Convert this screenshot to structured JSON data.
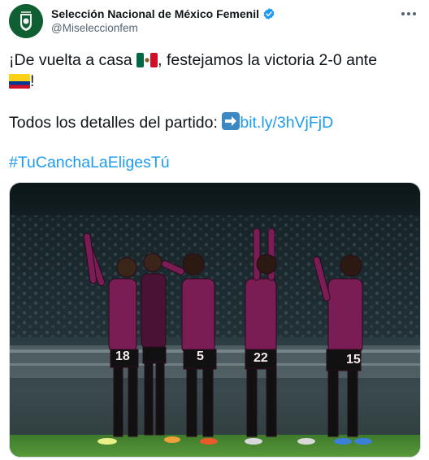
{
  "account": {
    "display_name": "Selección Nacional de México Femenil",
    "handle": "@Miseleccionfem",
    "verified": true,
    "brand_color": "#0f5f32"
  },
  "tweet": {
    "line1": "¡De vuelta a casa",
    "line1_after_flag": ", festejamos la victoria 2-0 ante",
    "line2_after_flag": "!",
    "details_label": "Todos los detalles del partido:",
    "link": "bit.ly/3hVjFjD",
    "hashtag": "#TuCanchaLaEligesTú",
    "link_color": "#1d9bf0"
  },
  "icons": {
    "more": "more-options-icon",
    "verified": "verified-badge-icon",
    "arrow": "right-arrow-icon",
    "flag_mexico": "mexico-flag-icon",
    "flag_colombia": "colombia-flag-icon"
  },
  "photo": {
    "jersey_numbers": [
      "18",
      "5",
      "22",
      "15"
    ],
    "jersey_color": "#7a1d55"
  }
}
